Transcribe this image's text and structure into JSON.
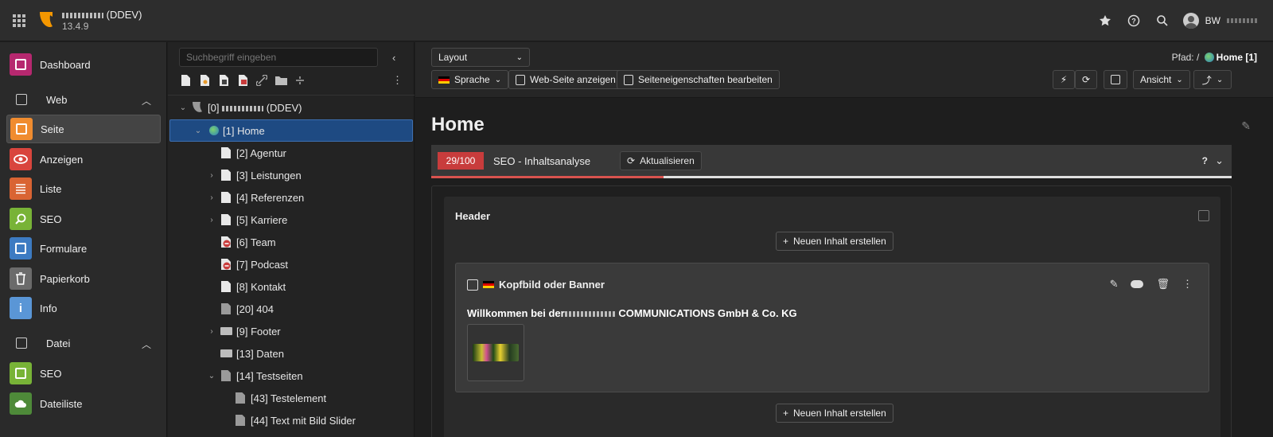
{
  "topbar": {
    "site_title": "(DDEV)",
    "version": "13.4.9",
    "user_initials": "BW"
  },
  "modules": {
    "dashboard": "Dashboard",
    "web_group": "Web",
    "seite": "Seite",
    "anzeigen": "Anzeigen",
    "liste": "Liste",
    "seo": "SEO",
    "formulare": "Formulare",
    "papierkorb": "Papierkorb",
    "info": "Info",
    "datei_group": "Datei",
    "datei_seo": "SEO",
    "dateiliste": "Dateiliste",
    "colors": {
      "dashboard": "#b6286f",
      "seite": "#f08c2f",
      "anzeigen": "#d9453d",
      "liste": "#d96433",
      "seo": "#78b337",
      "formulare": "#3d7bc2",
      "papierkorb": "#6b6b6b",
      "info": "#5a96d6",
      "datei_seo": "#78b337",
      "dateiliste": "#4e8a39"
    }
  },
  "tree": {
    "search_placeholder": "Suchbegriff eingeben",
    "root": "[0]",
    "root_suffix": "(DDEV)",
    "items": [
      "[1] Home",
      "[2] Agentur",
      "[3] Leistungen",
      "[4] Referenzen",
      "[5] Karriere",
      "[6] Team",
      "[7] Podcast",
      "[8] Kontakt",
      "[20] 404",
      "[9] Footer",
      "[13] Daten",
      "[14] Testseiten",
      "[43] Testelement",
      "[44] Text mit Bild Slider"
    ]
  },
  "docheader": {
    "layout_select": "Layout",
    "sprache": "Sprache",
    "view_page": "Web-Seite anzeigen",
    "edit_props": "Seiteneigenschaften bearbeiten",
    "path_label": "Pfad: /",
    "path_page": "Home [1]",
    "ansicht": "Ansicht"
  },
  "page": {
    "title": "Home",
    "seo_score": "29/100",
    "seo_score_fraction": 0.29,
    "seo_title": "SEO - Inhaltsanalyse",
    "seo_refresh": "Aktualisieren",
    "seo_help": "?",
    "column_title": "Header",
    "new_content": "Neuen Inhalt erstellen",
    "ce_title": "Kopfbild oder Banner",
    "ce_text_prefix": "Willkommen bei der",
    "ce_text_suffix": "COMMUNICATIONS GmbH & Co. KG"
  }
}
